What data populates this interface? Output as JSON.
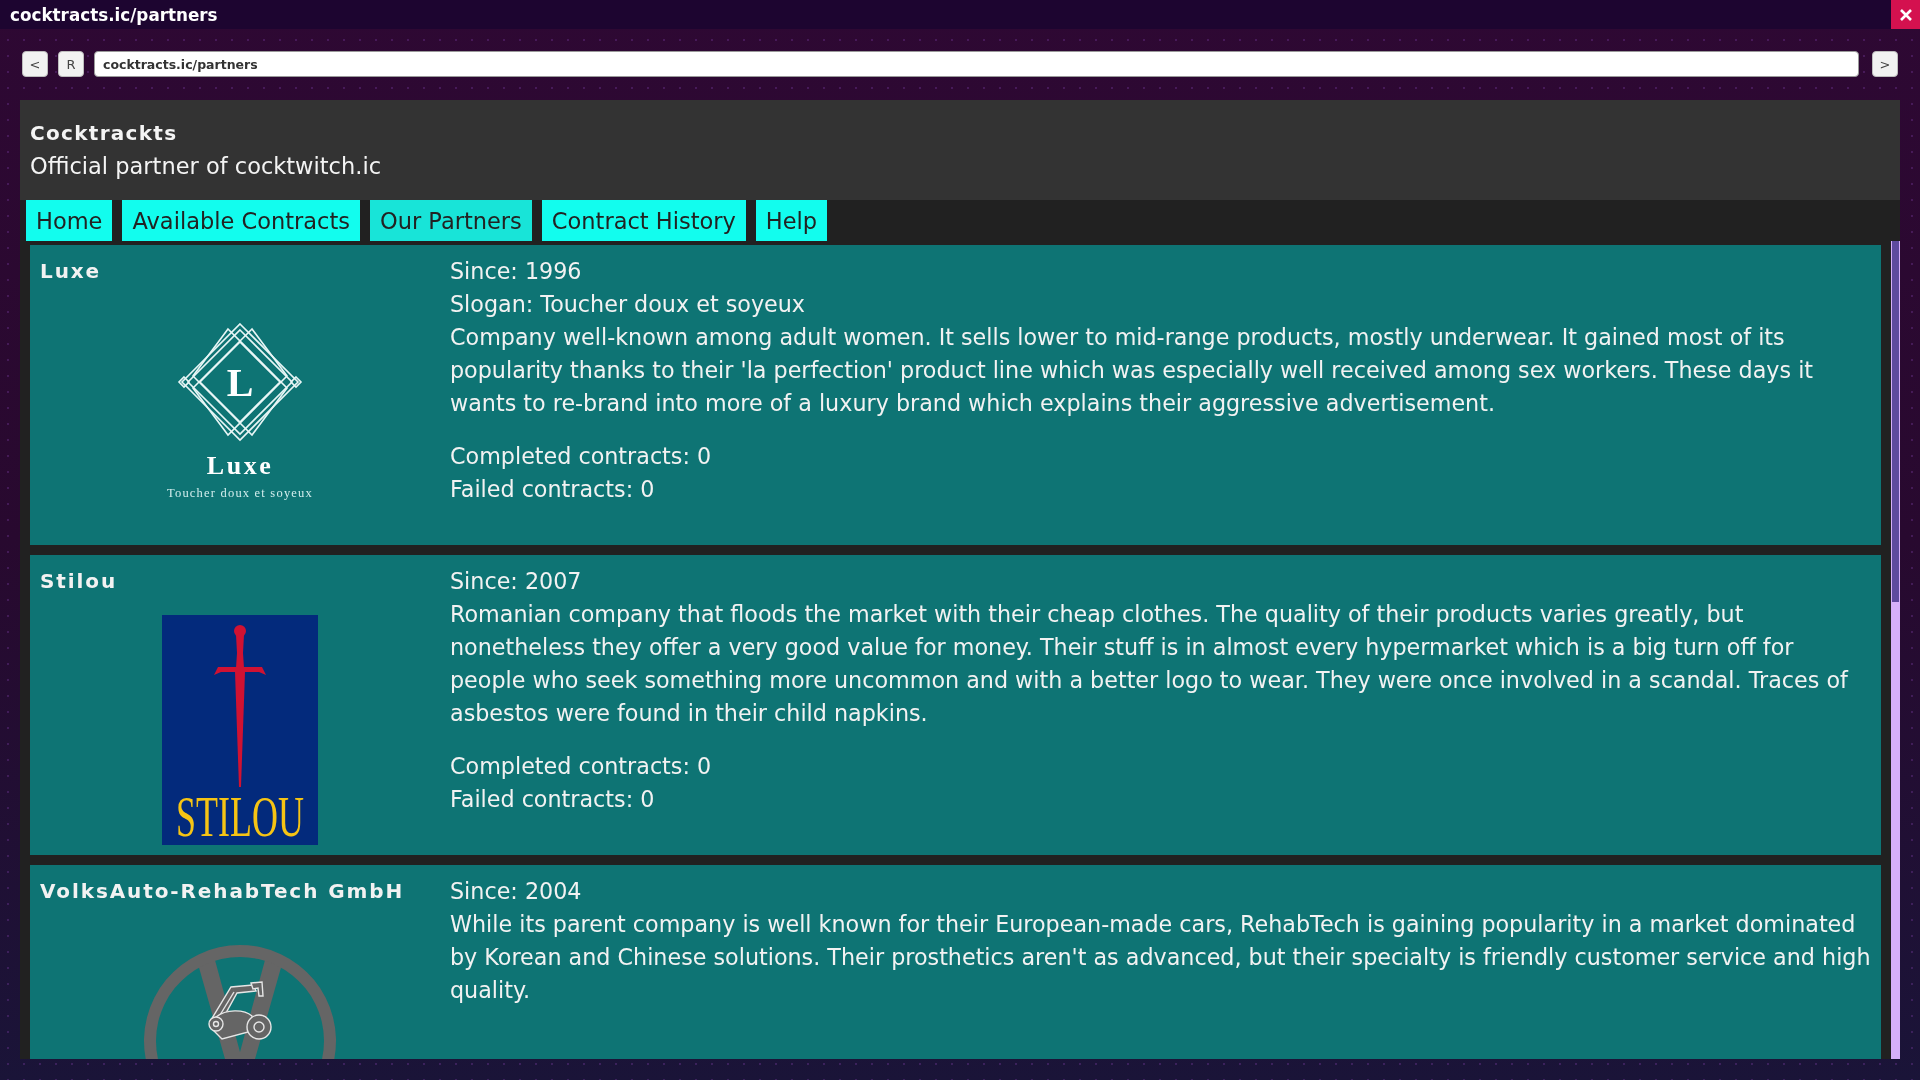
{
  "window": {
    "title": "cocktracts.ic/partners"
  },
  "toolbar": {
    "back": "<",
    "reload": "R",
    "address": "cocktracts.ic/partners",
    "go": ">"
  },
  "site": {
    "name": "Cocktrackts",
    "tagline": "Official partner of cocktwitch.ic"
  },
  "nav": [
    {
      "label": "Home",
      "selected": false
    },
    {
      "label": "Available Contracts",
      "selected": false
    },
    {
      "label": "Our Partners",
      "selected": true
    },
    {
      "label": "Contract History",
      "selected": false
    },
    {
      "label": "Help",
      "selected": false
    }
  ],
  "partners": [
    {
      "name": "Luxe",
      "logo": {
        "kind": "monogram",
        "letter": "L",
        "wordmark": "Luxe",
        "tagline": "Toucher doux et soyeux"
      },
      "since": "Since: 1996",
      "slogan": "Slogan: Toucher doux et soyeux",
      "description": "Company well-known among adult women. It sells lower to mid-range products, mostly underwear. It gained most of its popularity thanks to their 'la perfection' product line which was especially well received among sex workers. These days it wants to re-brand into more of a luxury brand which explains their aggressive advertisement.",
      "completed": "Completed contracts: 0",
      "failed": "Failed contracts: 0"
    },
    {
      "name": "Stilou",
      "logo": {
        "kind": "dagger",
        "wordmark": "STILOU"
      },
      "since": "Since: 2007",
      "description": "Romanian company that floods the market with their cheap clothes. The quality of their products varies greatly, but nonetheless they offer a very good value for money. Their stuff is in almost every hypermarket which is a big turn off for people who seek something more uncommon and with a better logo to wear. They were once involved in a scandal. Traces of asbestos were found in their child napkins.",
      "completed": "Completed contracts: 0",
      "failed": "Failed contracts: 0"
    },
    {
      "name": "VolksAuto-RehabTech GmbH",
      "logo": {
        "kind": "wheel"
      },
      "since": "Since: 2004",
      "description": "While its parent company is well known for their European-made cars, RehabTech is gaining popularity in a market dominated by Korean and Chinese solutions. Their prosthetics aren't as advanced, but their specialty is friendly customer service and high quality."
    }
  ]
}
